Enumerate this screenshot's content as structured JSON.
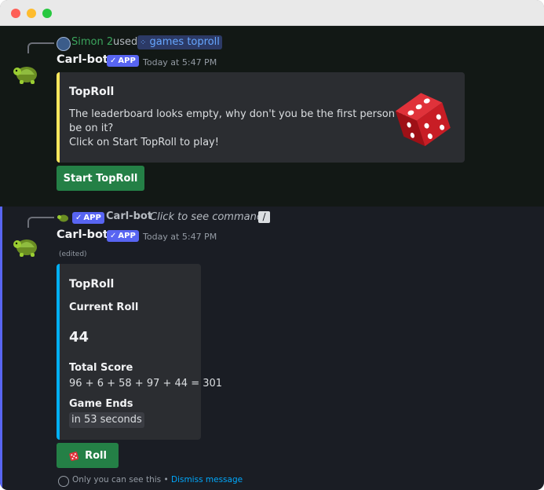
{
  "window": {
    "controls": [
      "close",
      "minimize",
      "maximize"
    ]
  },
  "message1": {
    "reply": {
      "user": "Simon 2",
      "used_text": "used",
      "command": "games toproll"
    },
    "author": {
      "name": "Carl-bot",
      "badge": "APP",
      "timestamp": "Today at 5:47 PM"
    },
    "embed": {
      "title": "TopRoll",
      "description_line1": "The leaderboard looks empty, why don't you be the first person to",
      "description_line2": "be on it?",
      "description_line3": "Click on Start TopRoll to play!",
      "accent_color": "#fee75c",
      "thumbnail_icon": "red-dice-icon"
    },
    "button": {
      "label": "Start TopRoll"
    }
  },
  "message2": {
    "reply": {
      "badge": "APP",
      "user": "Carl-bot",
      "hint": "Click to see command"
    },
    "author": {
      "name": "Carl-bot",
      "badge": "APP",
      "timestamp": "Today at 5:47 PM"
    },
    "edited": "(edited)",
    "embed": {
      "title": "TopRoll",
      "current_roll_label": "Current Roll",
      "current_roll_value": "44",
      "total_score_label": "Total Score",
      "total_score_value": "96 + 6 + 58 + 97 + 44 = 301",
      "game_ends_label": "Game Ends",
      "game_ends_value": "in 53 seconds",
      "accent_color": "#00b0f4"
    },
    "button": {
      "label": "Roll",
      "icon": "dice-icon"
    },
    "ephemeral": {
      "text": "Only you can see this •",
      "link": "Dismiss message"
    }
  },
  "colors": {
    "accent": "#5865f2",
    "button_green": "#248046",
    "link": "#00a8fc"
  }
}
